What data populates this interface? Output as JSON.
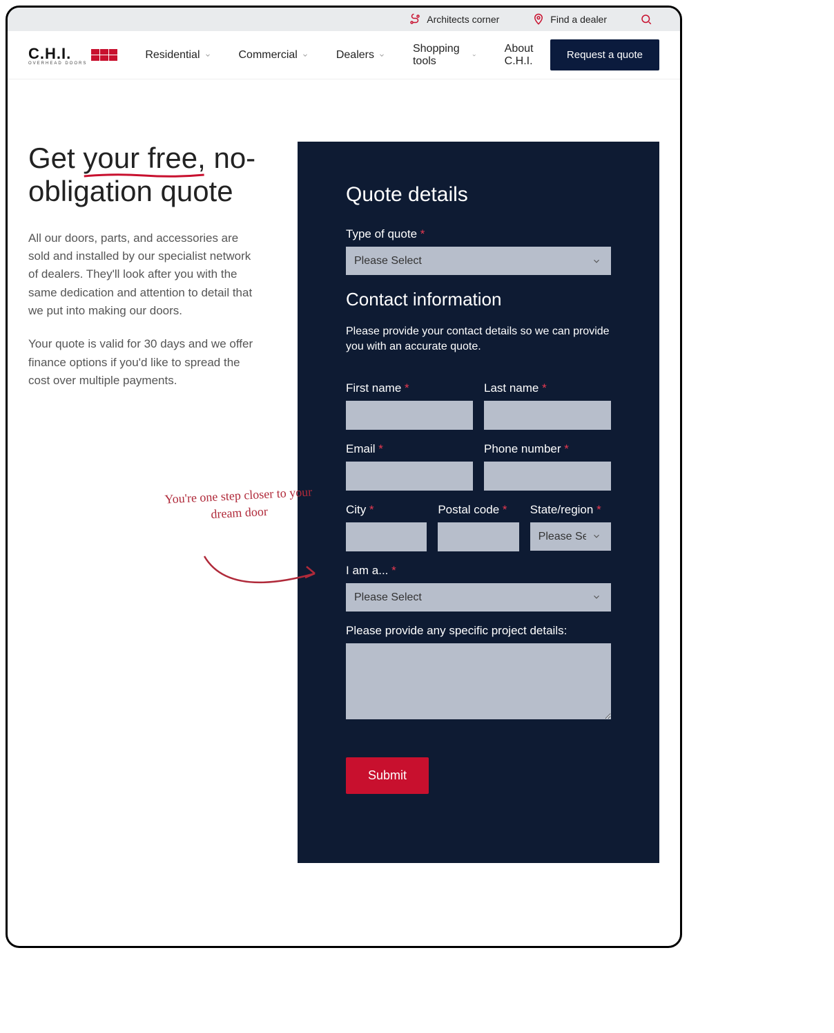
{
  "topbar": {
    "architects": "Architects corner",
    "find_dealer": "Find a dealer"
  },
  "logo": {
    "text": "C.H.I.",
    "sub": "OVERHEAD DOORS"
  },
  "nav": {
    "residential": "Residential",
    "commercial": "Commercial",
    "dealers": "Dealers",
    "shopping": "Shopping tools",
    "about": "About C.H.I.",
    "quote_btn": "Request a quote"
  },
  "hero": {
    "h1_pre": "Get ",
    "h1_underline": "your free,",
    "h1_post": " no-obligation quote",
    "p1": "All our doors, parts, and accessories are sold and installed by our specialist network of dealers. They'll look after you with the same dedication and attention to detail that we put into making our doors.",
    "p2": "Your quote is valid for 30 days and we offer finance options if you'd like to spread the cost over multiple payments."
  },
  "handwriting": "You're one step closer to your dream door",
  "form": {
    "title1": "Quote details",
    "label_type": "Type of quote",
    "select_placeholder": "Please Select",
    "title2": "Contact information",
    "intro": "Please provide your contact details so we can provide you with an accurate quote.",
    "label_first": "First name",
    "label_last": "Last name",
    "label_email": "Email",
    "label_phone": "Phone number",
    "label_city": "City",
    "label_postal": "Postal code",
    "label_state": "State/region",
    "state_placeholder": "Please Se",
    "label_iam": "I am a...",
    "label_details": "Please provide any specific project details:",
    "submit": "Submit"
  }
}
